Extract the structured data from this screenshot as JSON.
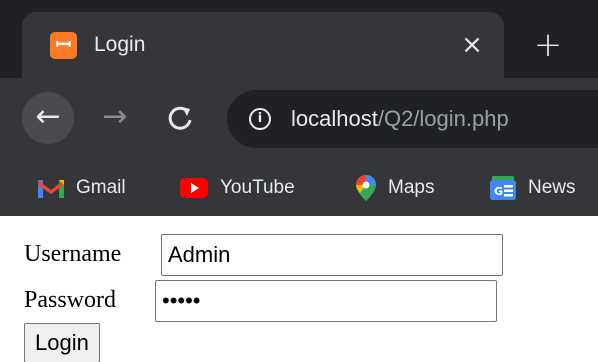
{
  "browser": {
    "tab": {
      "title": "Login",
      "favicon": "xampp-icon",
      "close_glyph": "×"
    },
    "new_tab_glyph": "+",
    "nav": {
      "back_glyph": "←",
      "forward_glyph": "→",
      "reload_glyph": "C"
    },
    "address": {
      "host": "localhost",
      "path": "/Q2/login.php",
      "info_glyph": "i"
    },
    "bookmarks": [
      {
        "label": "Gmail",
        "icon": "gmail-icon"
      },
      {
        "label": "YouTube",
        "icon": "youtube-icon"
      },
      {
        "label": "Maps",
        "icon": "maps-icon"
      },
      {
        "label": "News",
        "icon": "news-icon"
      }
    ],
    "colors": {
      "frame": "#202124",
      "toolbar": "#35363a",
      "text": "#e8eaed",
      "favicon": "#fb7a24"
    }
  },
  "form": {
    "username_label": "Username",
    "username_value": "Admin",
    "password_label": "Password",
    "password_value": "abcde",
    "submit_label": "Login"
  }
}
